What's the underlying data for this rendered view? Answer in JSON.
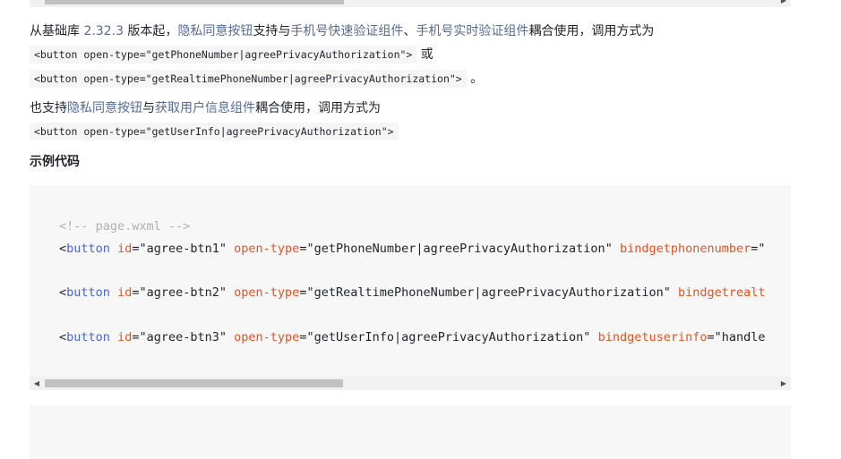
{
  "intro": {
    "prefix": "从基础库 ",
    "version": "2.32.3",
    "text1": " 版本起，",
    "link_privacy_button": "隐私同意按钮",
    "text2": "支持与",
    "link_phone_quick": "手机号快速验证组件",
    "sep": "、",
    "link_phone_realtime": "手机号实时验证组件",
    "text3": "耦合使用，调用方式为"
  },
  "code_line1": "<button open-type=\"getPhoneNumber|agreePrivacyAuthorization\">",
  "or_text": " 或",
  "code_line2": "<button open-type=\"getRealtimePhoneNumber|agreePrivacyAuthorization\">",
  "period": " 。",
  "also": {
    "prefix": "也支持",
    "link_privacy_button": "隐私同意按钮",
    "text1": "与",
    "link_userinfo": "获取用户信息组件",
    "text2": "耦合使用，调用方式为"
  },
  "code_line3": "<button open-type=\"getUserInfo|agreePrivacyAuthorization\">",
  "section_heading": "示例代码",
  "code_block": {
    "comment": "<!-- page.wxml -->",
    "lines": [
      {
        "tag": "button",
        "id_attr": "id",
        "id_val": "\"agree-btn1\"",
        "type_attr": "open-type",
        "type_val": "\"getPhoneNumber|agreePrivacyAuthorization\"",
        "bind_attr": "bindgetphonenumber",
        "bind_val": "=\""
      },
      {
        "tag": "button",
        "id_attr": "id",
        "id_val": "\"agree-btn2\"",
        "type_attr": "open-type",
        "type_val": "\"getRealtimePhoneNumber|agreePrivacyAuthorization\"",
        "bind_attr": "bindgetrealt",
        "bind_val": ""
      },
      {
        "tag": "button",
        "id_attr": "id",
        "id_val": "\"agree-btn3\"",
        "type_attr": "open-type",
        "type_val": "\"getUserInfo|agreePrivacyAuthorization\"",
        "bind_attr": "bindgetuserinfo",
        "bind_val": "=\"handle"
      }
    ]
  },
  "icons": {
    "scroll_left": "scroll-left-arrow-icon",
    "scroll_right": "scroll-right-arrow-icon"
  },
  "colors": {
    "link": "#576b95",
    "code_tag": "#4665c9",
    "code_attr": "#e3531f",
    "code_comment": "#b0b0b0",
    "code_bg": "#f7f7f7"
  }
}
